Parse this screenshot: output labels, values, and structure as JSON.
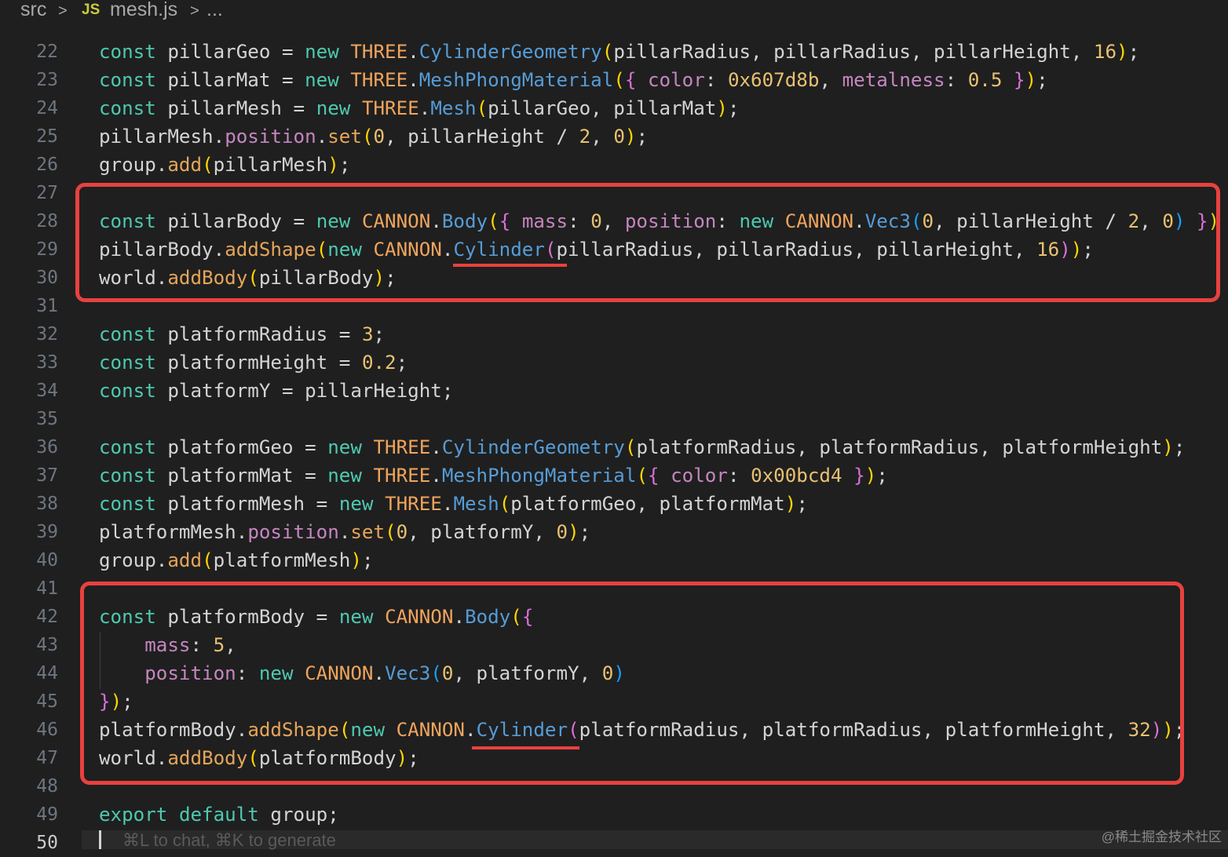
{
  "breadcrumb": {
    "folder": "src",
    "sep1": ">",
    "file_icon": "JS",
    "file": "mesh.js",
    "sep2": ">",
    "more": "..."
  },
  "lines": [
    {
      "n": "22",
      "tokens": [
        [
          "kw",
          "const"
        ],
        [
          "v",
          " pillarGeo = "
        ],
        [
          "kw",
          "new"
        ],
        [
          "v",
          " "
        ],
        [
          "cls",
          "THREE"
        ],
        [
          "v",
          "."
        ],
        [
          "fn",
          "CylinderGeometry"
        ],
        [
          "b1",
          "("
        ],
        [
          "v",
          "pillarRadius, pillarRadius, pillarHeight, "
        ],
        [
          "num",
          "16"
        ],
        [
          "b1",
          ")"
        ],
        [
          "v",
          ";"
        ]
      ]
    },
    {
      "n": "23",
      "tokens": [
        [
          "kw",
          "const"
        ],
        [
          "v",
          " pillarMat = "
        ],
        [
          "kw",
          "new"
        ],
        [
          "v",
          " "
        ],
        [
          "cls",
          "THREE"
        ],
        [
          "v",
          "."
        ],
        [
          "fn",
          "MeshPhongMaterial"
        ],
        [
          "b1",
          "("
        ],
        [
          "b2",
          "{"
        ],
        [
          "v",
          " "
        ],
        [
          "prop",
          "color"
        ],
        [
          "v",
          ": "
        ],
        [
          "num",
          "0x607d8b"
        ],
        [
          "v",
          ", "
        ],
        [
          "prop",
          "metalness"
        ],
        [
          "v",
          ": "
        ],
        [
          "num",
          "0.5"
        ],
        [
          "v",
          " "
        ],
        [
          "b2",
          "}"
        ],
        [
          "b1",
          ")"
        ],
        [
          "v",
          ";"
        ]
      ]
    },
    {
      "n": "24",
      "tokens": [
        [
          "kw",
          "const"
        ],
        [
          "v",
          " pillarMesh = "
        ],
        [
          "kw",
          "new"
        ],
        [
          "v",
          " "
        ],
        [
          "cls",
          "THREE"
        ],
        [
          "v",
          "."
        ],
        [
          "fn",
          "Mesh"
        ],
        [
          "b1",
          "("
        ],
        [
          "v",
          "pillarGeo, pillarMat"
        ],
        [
          "b1",
          ")"
        ],
        [
          "v",
          ";"
        ]
      ]
    },
    {
      "n": "25",
      "tokens": [
        [
          "v",
          "pillarMesh."
        ],
        [
          "prop",
          "position"
        ],
        [
          "v",
          "."
        ],
        [
          "meth",
          "set"
        ],
        [
          "b1",
          "("
        ],
        [
          "num",
          "0"
        ],
        [
          "v",
          ", pillarHeight / "
        ],
        [
          "num",
          "2"
        ],
        [
          "v",
          ", "
        ],
        [
          "num",
          "0"
        ],
        [
          "b1",
          ")"
        ],
        [
          "v",
          ";"
        ]
      ]
    },
    {
      "n": "26",
      "tokens": [
        [
          "v",
          "group."
        ],
        [
          "meth",
          "add"
        ],
        [
          "b1",
          "("
        ],
        [
          "v",
          "pillarMesh"
        ],
        [
          "b1",
          ")"
        ],
        [
          "v",
          ";"
        ]
      ]
    },
    {
      "n": "27",
      "tokens": []
    },
    {
      "n": "28",
      "tokens": [
        [
          "kw",
          "const"
        ],
        [
          "v",
          " pillarBody = "
        ],
        [
          "kw",
          "new"
        ],
        [
          "v",
          " "
        ],
        [
          "cls",
          "CANNON"
        ],
        [
          "v",
          "."
        ],
        [
          "fn",
          "Body"
        ],
        [
          "b1",
          "("
        ],
        [
          "b2",
          "{"
        ],
        [
          "v",
          " "
        ],
        [
          "prop",
          "mass"
        ],
        [
          "v",
          ": "
        ],
        [
          "num",
          "0"
        ],
        [
          "v",
          ", "
        ],
        [
          "prop",
          "position"
        ],
        [
          "v",
          ": "
        ],
        [
          "kw",
          "new"
        ],
        [
          "v",
          " "
        ],
        [
          "cls",
          "CANNON"
        ],
        [
          "v",
          "."
        ],
        [
          "fn",
          "Vec3"
        ],
        [
          "b3",
          "("
        ],
        [
          "num",
          "0"
        ],
        [
          "v",
          ", pillarHeight / "
        ],
        [
          "num",
          "2"
        ],
        [
          "v",
          ", "
        ],
        [
          "num",
          "0"
        ],
        [
          "b3",
          ")"
        ],
        [
          "v",
          " "
        ],
        [
          "b2",
          "}"
        ],
        [
          "b1",
          ")"
        ]
      ]
    },
    {
      "n": "29",
      "tokens": [
        [
          "v",
          "pillarBody."
        ],
        [
          "meth",
          "addShape"
        ],
        [
          "b1",
          "("
        ],
        [
          "kw",
          "new"
        ],
        [
          "v",
          " "
        ],
        [
          "cls",
          "CANNON"
        ],
        [
          "v",
          "."
        ],
        [
          "fn",
          "Cylinder"
        ],
        [
          "b2",
          "("
        ],
        [
          "v",
          "pillarRadius, pillarRadius, pillarHeight, "
        ],
        [
          "num",
          "16"
        ],
        [
          "b2",
          ")"
        ],
        [
          "b1",
          ")"
        ],
        [
          "v",
          ";"
        ]
      ]
    },
    {
      "n": "30",
      "tokens": [
        [
          "v",
          "world."
        ],
        [
          "meth",
          "addBody"
        ],
        [
          "b1",
          "("
        ],
        [
          "v",
          "pillarBody"
        ],
        [
          "b1",
          ")"
        ],
        [
          "v",
          ";"
        ]
      ]
    },
    {
      "n": "31",
      "tokens": []
    },
    {
      "n": "32",
      "tokens": [
        [
          "kw",
          "const"
        ],
        [
          "v",
          " platformRadius = "
        ],
        [
          "num",
          "3"
        ],
        [
          "v",
          ";"
        ]
      ]
    },
    {
      "n": "33",
      "tokens": [
        [
          "kw",
          "const"
        ],
        [
          "v",
          " platformHeight = "
        ],
        [
          "num",
          "0.2"
        ],
        [
          "v",
          ";"
        ]
      ]
    },
    {
      "n": "34",
      "tokens": [
        [
          "kw",
          "const"
        ],
        [
          "v",
          " platformY = pillarHeight;"
        ]
      ]
    },
    {
      "n": "35",
      "tokens": []
    },
    {
      "n": "36",
      "tokens": [
        [
          "kw",
          "const"
        ],
        [
          "v",
          " platformGeo = "
        ],
        [
          "kw",
          "new"
        ],
        [
          "v",
          " "
        ],
        [
          "cls",
          "THREE"
        ],
        [
          "v",
          "."
        ],
        [
          "fn",
          "CylinderGeometry"
        ],
        [
          "b1",
          "("
        ],
        [
          "v",
          "platformRadius, platformRadius, platformHeight"
        ],
        [
          "b1",
          ")"
        ],
        [
          "v",
          ";"
        ]
      ]
    },
    {
      "n": "37",
      "tokens": [
        [
          "kw",
          "const"
        ],
        [
          "v",
          " platformMat = "
        ],
        [
          "kw",
          "new"
        ],
        [
          "v",
          " "
        ],
        [
          "cls",
          "THREE"
        ],
        [
          "v",
          "."
        ],
        [
          "fn",
          "MeshPhongMaterial"
        ],
        [
          "b1",
          "("
        ],
        [
          "b2",
          "{"
        ],
        [
          "v",
          " "
        ],
        [
          "prop",
          "color"
        ],
        [
          "v",
          ": "
        ],
        [
          "num",
          "0x00bcd4"
        ],
        [
          "v",
          " "
        ],
        [
          "b2",
          "}"
        ],
        [
          "b1",
          ")"
        ],
        [
          "v",
          ";"
        ]
      ]
    },
    {
      "n": "38",
      "tokens": [
        [
          "kw",
          "const"
        ],
        [
          "v",
          " platformMesh = "
        ],
        [
          "kw",
          "new"
        ],
        [
          "v",
          " "
        ],
        [
          "cls",
          "THREE"
        ],
        [
          "v",
          "."
        ],
        [
          "fn",
          "Mesh"
        ],
        [
          "b1",
          "("
        ],
        [
          "v",
          "platformGeo, platformMat"
        ],
        [
          "b1",
          ")"
        ],
        [
          "v",
          ";"
        ]
      ]
    },
    {
      "n": "39",
      "tokens": [
        [
          "v",
          "platformMesh."
        ],
        [
          "prop",
          "position"
        ],
        [
          "v",
          "."
        ],
        [
          "meth",
          "set"
        ],
        [
          "b1",
          "("
        ],
        [
          "num",
          "0"
        ],
        [
          "v",
          ", platformY, "
        ],
        [
          "num",
          "0"
        ],
        [
          "b1",
          ")"
        ],
        [
          "v",
          ";"
        ]
      ]
    },
    {
      "n": "40",
      "tokens": [
        [
          "v",
          "group."
        ],
        [
          "meth",
          "add"
        ],
        [
          "b1",
          "("
        ],
        [
          "v",
          "platformMesh"
        ],
        [
          "b1",
          ")"
        ],
        [
          "v",
          ";"
        ]
      ]
    },
    {
      "n": "41",
      "tokens": []
    },
    {
      "n": "42",
      "tokens": [
        [
          "kw",
          "const"
        ],
        [
          "v",
          " platformBody = "
        ],
        [
          "kw",
          "new"
        ],
        [
          "v",
          " "
        ],
        [
          "cls",
          "CANNON"
        ],
        [
          "v",
          "."
        ],
        [
          "fn",
          "Body"
        ],
        [
          "b1",
          "("
        ],
        [
          "b2",
          "{"
        ]
      ]
    },
    {
      "n": "43",
      "tokens": [
        [
          "v",
          "    "
        ],
        [
          "prop",
          "mass"
        ],
        [
          "v",
          ": "
        ],
        [
          "num",
          "5"
        ],
        [
          "v",
          ","
        ]
      ]
    },
    {
      "n": "44",
      "tokens": [
        [
          "v",
          "    "
        ],
        [
          "prop",
          "position"
        ],
        [
          "v",
          ": "
        ],
        [
          "kw",
          "new"
        ],
        [
          "v",
          " "
        ],
        [
          "cls",
          "CANNON"
        ],
        [
          "v",
          "."
        ],
        [
          "fn",
          "Vec3"
        ],
        [
          "b3",
          "("
        ],
        [
          "num",
          "0"
        ],
        [
          "v",
          ", platformY, "
        ],
        [
          "num",
          "0"
        ],
        [
          "b3",
          ")"
        ]
      ]
    },
    {
      "n": "45",
      "tokens": [
        [
          "b2",
          "}"
        ],
        [
          "b1",
          ")"
        ],
        [
          "v",
          ";"
        ]
      ]
    },
    {
      "n": "46",
      "tokens": [
        [
          "v",
          "platformBody."
        ],
        [
          "meth",
          "addShape"
        ],
        [
          "b1",
          "("
        ],
        [
          "kw",
          "new"
        ],
        [
          "v",
          " "
        ],
        [
          "cls",
          "CANNON"
        ],
        [
          "v",
          "."
        ],
        [
          "fn",
          "Cylinder"
        ],
        [
          "b2",
          "("
        ],
        [
          "v",
          "platformRadius, platformRadius, platformHeight, "
        ],
        [
          "num",
          "32"
        ],
        [
          "b2",
          ")"
        ],
        [
          "b1",
          ")"
        ],
        [
          "v",
          ";"
        ]
      ]
    },
    {
      "n": "47",
      "tokens": [
        [
          "v",
          "world."
        ],
        [
          "meth",
          "addBody"
        ],
        [
          "b1",
          "("
        ],
        [
          "v",
          "platformBody"
        ],
        [
          "b1",
          ")"
        ],
        [
          "v",
          ";"
        ]
      ]
    },
    {
      "n": "48",
      "tokens": []
    },
    {
      "n": "49",
      "tokens": [
        [
          "kw",
          "export"
        ],
        [
          "v",
          " "
        ],
        [
          "kw",
          "default"
        ],
        [
          "v",
          " group;"
        ]
      ]
    },
    {
      "n": "50",
      "tokens": []
    }
  ],
  "active_line": "50",
  "ghost_hint": "⌘L to chat, ⌘K to generate",
  "watermark": "@稀土掘金技术社区",
  "colors": {
    "background": "#1f1f1f",
    "annotation_red": "#e8413f",
    "keyword": "#4ec9b0",
    "class": "#f0a45d",
    "function": "#569cd6",
    "method": "#e5a55a",
    "property": "#c586c0",
    "number": "#e8c171"
  }
}
